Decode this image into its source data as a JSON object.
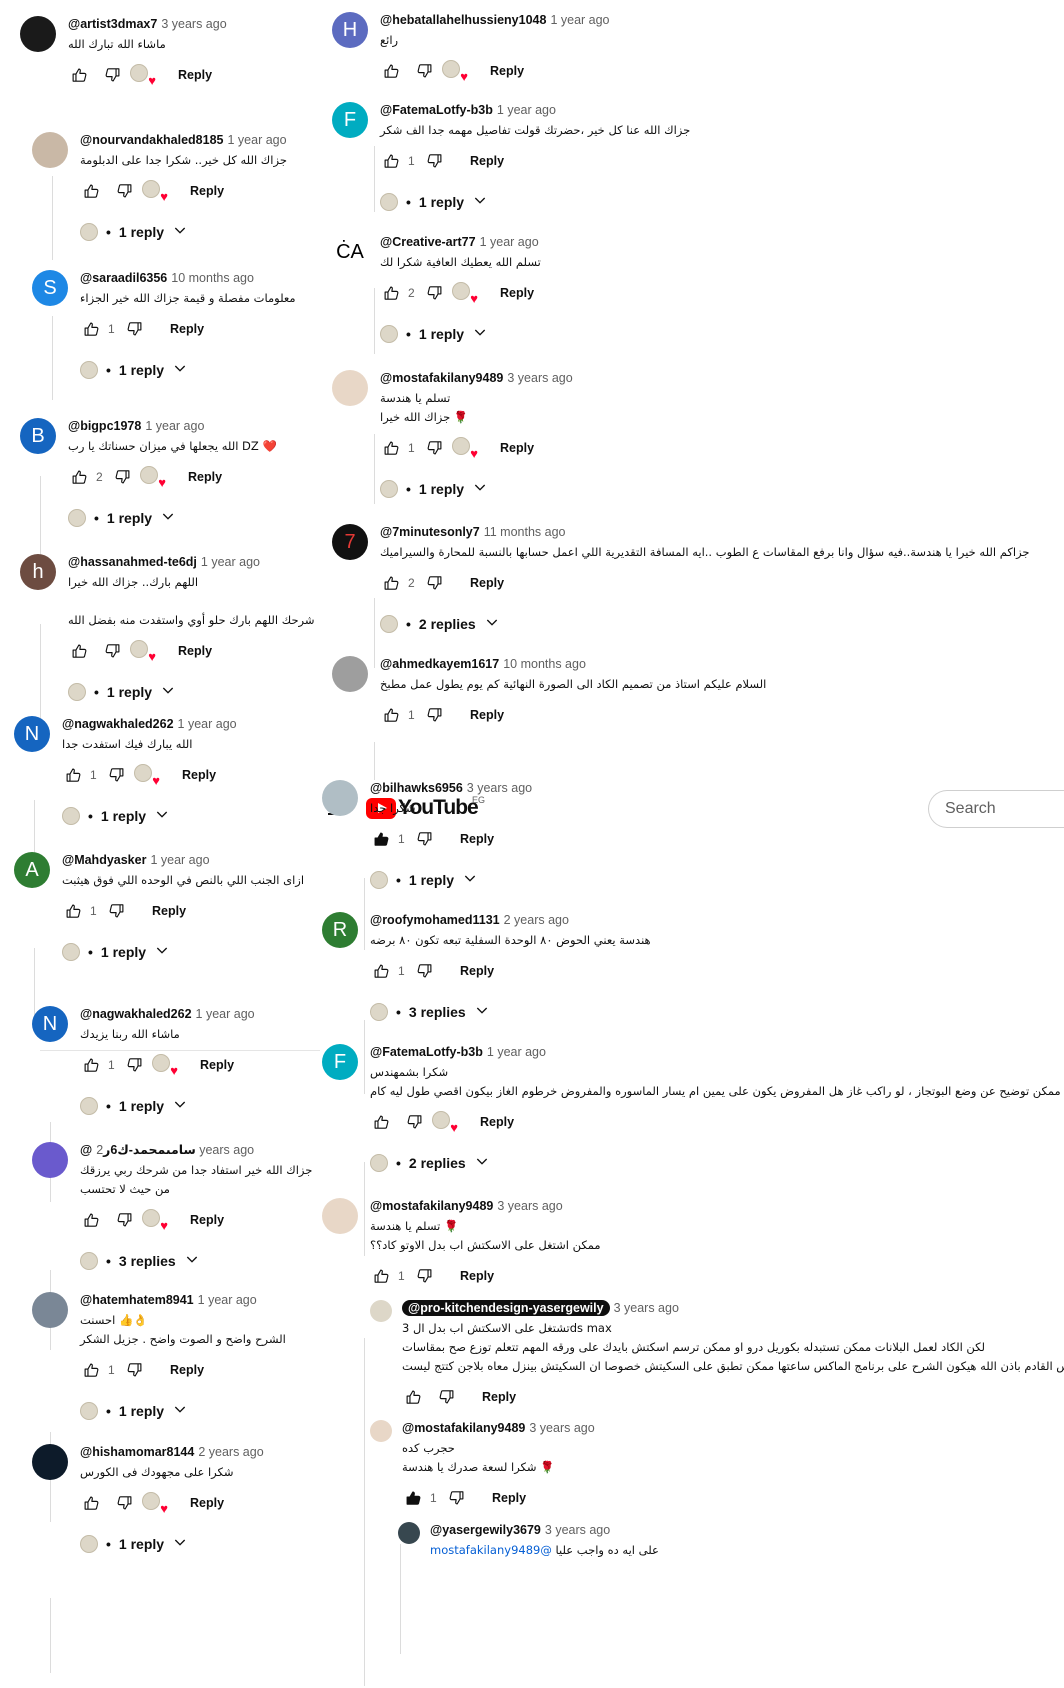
{
  "header": {
    "logo_text": "YouTube",
    "country": "EG",
    "search_placeholder": "Search"
  },
  "ui": {
    "reply_label": "Reply"
  },
  "icons": {
    "like": "thumb-up-icon",
    "dislike": "thumb-down-icon",
    "heart": "creator-heart-icon",
    "menu": "hamburger-menu-icon",
    "expand": "chevron-down-icon"
  },
  "colors": {
    "heart": "#ff0033",
    "youtube_red": "#ff0000"
  },
  "comments": [
    {
      "author": "@artist3dmax7",
      "time": "3 years ago",
      "lines": [
        "ماشاء الله تبارك الله"
      ],
      "likes": "",
      "replies": ""
    },
    {
      "author": "@nourvandakhaled8185",
      "time": "1 year ago",
      "lines": [
        "جزاك الله كل خير.. شكرا جدا على الدبلومة"
      ],
      "likes": "",
      "replies": "1 reply"
    },
    {
      "author": "@saraadil6356",
      "time": "10 months ago",
      "lines": [
        "معلومات مفصلة و قيمة جزاك الله خير الجزاء"
      ],
      "likes": "1",
      "replies": "1 reply"
    },
    {
      "author": "@bigpc1978",
      "time": "1 year ago",
      "lines": [
        "الله يجعلها في ميزان حسناتك يا رب DZ ❤️"
      ],
      "likes": "2",
      "replies": "1 reply"
    },
    {
      "author": "@hassanahmed-te6dj",
      "time": "1 year ago",
      "lines": [
        "اللهم بارك.. جزاك الله خيرا",
        "",
        "شرحك اللهم بارك حلو أوي واستفدت منه بفضل الله"
      ],
      "likes": "",
      "replies": "1 reply"
    },
    {
      "author": "@nagwakhaled262",
      "time": "1 year ago",
      "lines": [
        "الله يبارك فيك استفدت جدا"
      ],
      "likes": "1",
      "replies": "1 reply"
    },
    {
      "author": "@Mahdyasker",
      "time": "1 year ago",
      "lines": [
        "ازاى الجنب اللي بالنص في الوحده اللي فوق هيثبت"
      ],
      "likes": "1",
      "replies": "1 reply"
    },
    {
      "author": "@nagwakhaled262",
      "time": "1 year ago",
      "lines": [
        "ماشاء الله ربنا يزيدك"
      ],
      "likes": "1",
      "replies": "1 reply"
    },
    {
      "author": "@سامىمحمد-ك6ر",
      "time": "2 years ago",
      "lines": [
        "جزاك الله خير استفاد جدا من شرحك ربي يرزقك",
        "من حيث لا تحتسب"
      ],
      "likes": "",
      "replies": "3 replies"
    },
    {
      "author": "@hatemhatem8941",
      "time": "1 year ago",
      "lines": [
        "احسنت 👍👌",
        "الشرح واضح و الصوت واضح . جزيل الشكر"
      ],
      "likes": "1",
      "replies": "1 reply"
    },
    {
      "author": "@hishamomar8144",
      "time": "2 years ago",
      "lines": [
        "شكرا على مجهودك فى الكورس"
      ],
      "likes": "",
      "replies": "1 reply"
    },
    {
      "author": "@hebatallahelhussieny1048",
      "time": "1 year ago",
      "lines": [
        "رائع"
      ],
      "likes": "",
      "replies": ""
    },
    {
      "author": "@FatemaLotfy-b3b",
      "time": "1 year ago",
      "lines": [
        "جزاك الله عنا كل خير ،حضرتك قولت تفاصيل مهمه جدا الف شكر"
      ],
      "likes": "1",
      "replies": "1 reply"
    },
    {
      "author": "@Creative-art77",
      "time": "1 year ago",
      "lines": [
        "تسلم الله يعطيك العافية شكرا لك"
      ],
      "likes": "2",
      "replies": "1 reply"
    },
    {
      "author": "@mostafakilany9489",
      "time": "3 years ago",
      "lines": [
        "تسلم يا هندسة",
        "جزاك الله خيرا 🌹"
      ],
      "likes": "1",
      "replies": "1 reply"
    },
    {
      "author": "@7minutesonly7",
      "time": "11 months ago",
      "lines": [
        "جزاكم الله خيرا يا هندسة..فيه سؤال وانا برفع المقاسات ع الطوب ..ايه المسافة التقديرية اللي اعمل حسابها بالنسبة للمحارة والسيراميك"
      ],
      "likes": "2",
      "replies": "2 replies"
    },
    {
      "author": "@ahmedkayem1617",
      "time": "10 months ago",
      "lines": [
        "السلام عليكم استاذ من تصميم الكاد الى الصورة النهائية كم يوم يطول عمل مطبخ"
      ],
      "likes": "1",
      "replies": ""
    },
    {
      "author": "@bilhawks6956",
      "time": "3 years ago",
      "lines": [
        "شكرا جدا"
      ],
      "likes": "1",
      "replies": "1 reply"
    },
    {
      "author": "@roofymohamed1131",
      "time": "2 years ago",
      "lines": [
        "هندسة يعني الحوض ٨٠ الوحدة السفلية تبعه تكون ٨٠ برضه"
      ],
      "likes": "1",
      "replies": "3 replies"
    },
    {
      "author": "@FatemaLotfy-b3b",
      "time": "1 year ago",
      "lines": [
        "شكرا بشمهندس",
        "ممكن توضيح عن وضع البوتجاز ، لو راكب غاز هل المفروض يكون على يمين ام يسار الماسوره والمفروض خرطوم الغاز بيكون اقصي طول ليه كام"
      ],
      "likes": "",
      "replies": "2 replies"
    },
    {
      "author": "@mostafakilany9489",
      "time": "3 years ago",
      "lines": [
        "تسلم يا هندسة 🌹",
        "ممكن اشتغل على الاسكتش اب بدل الاوتو كاد؟؟"
      ],
      "likes": "1",
      "replies": ""
    },
    {
      "author": "@pro-kitchendesign-yasergewily",
      "time": "3 years ago",
      "lines": [
        "تشتغل على الاسكتش اب بدل ال 3ds max",
        "لكن الكاد لعمل البلانات ممكن تستبدله بكوريل درو او ممكن ترسم اسكتش بايدك على ورقه المهم تتعلم توزع صح بمقاسات",
        "والدرس القادم باذن الله هيكون الشرح على برنامج الماكس ساعتها ممكن تطبق على السكيتش خصوصا ان السكيتش بينزل معاه بلاجن كتتج ليست"
      ],
      "likes": "",
      "replies": ""
    },
    {
      "author": "@mostafakilany9489",
      "time": "3 years ago",
      "lines": [
        "حجرب كده",
        "شكرا لسعة صدرك يا هندسة 🌹"
      ],
      "likes": "1",
      "replies": ""
    },
    {
      "author": "@yasergewily3679",
      "time": "3 years ago",
      "mention": "@mostafakilany9489",
      "lines": [
        "على ايه ده واجب عليا"
      ],
      "likes": "",
      "replies": ""
    }
  ]
}
